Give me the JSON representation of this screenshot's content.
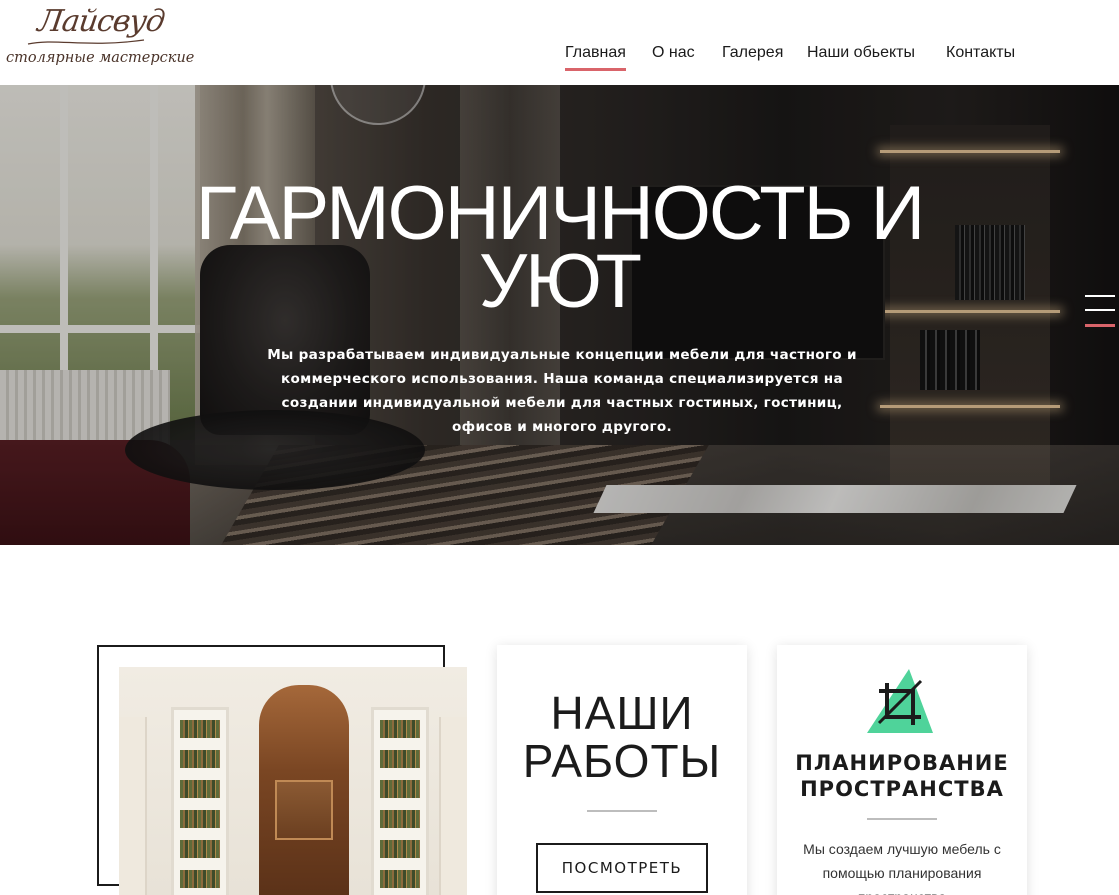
{
  "header": {
    "logo": {
      "script": "Лайсвуд",
      "subtitle": "столярные мастерские"
    },
    "nav": [
      {
        "label": "Главная",
        "active": true
      },
      {
        "label": "О нас",
        "active": false
      },
      {
        "label": "Галерея",
        "active": false
      },
      {
        "label": "Наши обьекты",
        "active": false
      },
      {
        "label": "Контакты",
        "active": false
      }
    ],
    "accent_color": "#d9646a"
  },
  "hero": {
    "title_line1": "ГАРМОНИЧНОСТЬ И",
    "title_line2": "УЮТ",
    "text": "Мы разрабатываем индивидуальные концепции мебели для частного и коммерческого использования. Наша команда специализируется на создании индивидуальной мебели для частных гостиных, гостиниц, офисов и многого другого.",
    "menu_icon": "hamburger-menu-icon"
  },
  "cards": {
    "works": {
      "title_line1": "НАШИ",
      "title_line2": "РАБОТЫ",
      "button_label": "ПОСМОТРЕТЬ"
    },
    "planning": {
      "icon": "crop-icon",
      "icon_color": "#4fd39a",
      "title_line1": "ПЛАНИРОВАНИЕ",
      "title_line2": "ПРОСТРАНСТВА",
      "text": "Мы создаем лучшую мебель с помощью планирования пространства"
    }
  }
}
